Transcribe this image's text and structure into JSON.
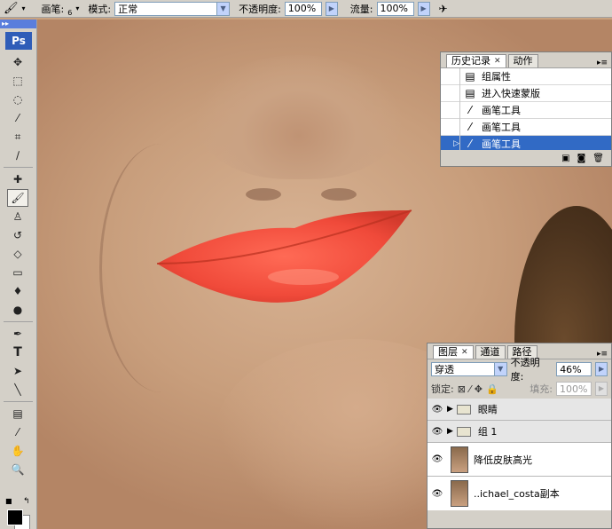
{
  "options_bar": {
    "brush_label": "画笔:",
    "brush_size": "6",
    "mode_label": "模式:",
    "mode_value": "正常",
    "opacity_label": "不透明度:",
    "opacity_value": "100%",
    "flow_label": "流量:",
    "flow_value": "100%"
  },
  "toolbox": {
    "logo": "Ps",
    "tools": [
      "move-icon",
      "marquee-icon",
      "lasso-icon",
      "magic-wand-icon",
      "crop-icon",
      "slice-icon",
      "healing-icon",
      "brush-icon",
      "stamp-icon",
      "history-brush-icon",
      "eraser-icon",
      "gradient-icon",
      "blur-icon",
      "dodge-icon",
      "pen-icon",
      "type-icon",
      "path-select-icon",
      "line-icon",
      "notes-icon",
      "eyedropper-icon",
      "hand-icon",
      "zoom-icon"
    ],
    "type_glyph": "T",
    "foreground": "#000000",
    "background": "#ffffff"
  },
  "history_panel": {
    "tabs": [
      "历史记录",
      "动作"
    ],
    "items": [
      {
        "label": "组属性",
        "icon": "doc-icon"
      },
      {
        "label": "进入快速蒙版",
        "icon": "doc-icon"
      },
      {
        "label": "画笔工具",
        "icon": "brush-icon"
      },
      {
        "label": "画笔工具",
        "icon": "brush-icon"
      },
      {
        "label": "画笔工具",
        "icon": "brush-icon",
        "selected": true
      }
    ]
  },
  "layers_panel": {
    "tabs": [
      "图层",
      "通道",
      "路径"
    ],
    "blend_mode": "穿透",
    "opacity_label": "不透明度:",
    "opacity_value": "46%",
    "lock_label": "锁定:",
    "fill_label": "填充:",
    "fill_value": "100%",
    "layers": [
      {
        "name": "眼睛",
        "type": "group"
      },
      {
        "name": "组 1",
        "type": "group"
      },
      {
        "name": "降低皮肤高光",
        "type": "image"
      },
      {
        "name": "..ichael_costa副本",
        "type": "smart"
      }
    ]
  },
  "colors": {
    "selection": "#316ac5",
    "lip": "#f04a3a",
    "panel_bg": "#d4d0c8"
  }
}
